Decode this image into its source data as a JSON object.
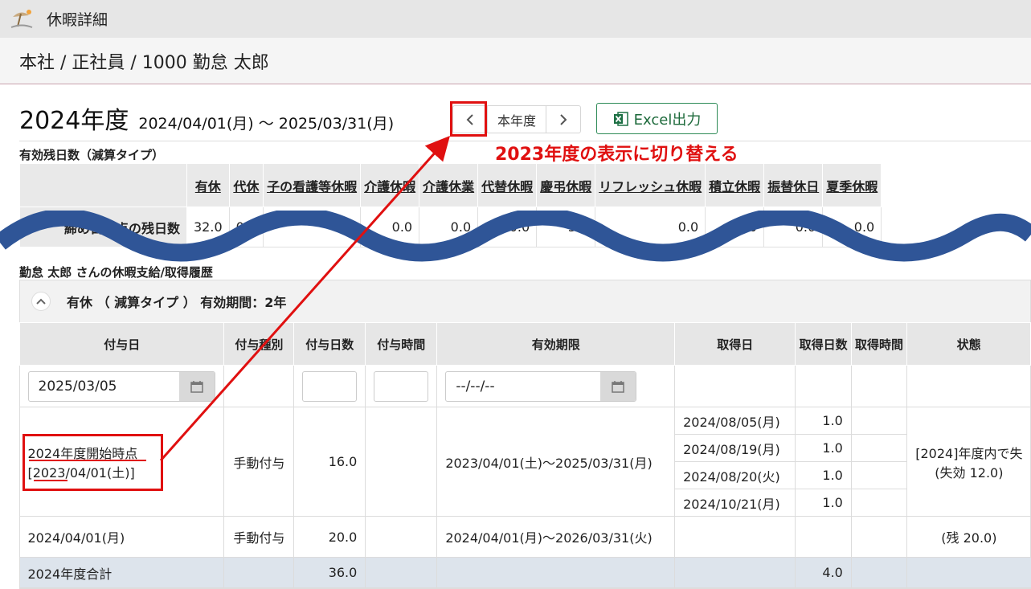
{
  "window": {
    "title": "休暇詳細"
  },
  "employee": {
    "path": "本社 / 正社員 / 1000 勤怠 太郎"
  },
  "year": {
    "title": "2024年度",
    "range": "2024/04/01(月) ～ 2025/03/31(月)",
    "current_label": "本年度",
    "excel_label": "Excel出力"
  },
  "annotation": {
    "text": "2023年度の表示に切り替える"
  },
  "balance": {
    "section_label": "有効残日数（減算タイプ）",
    "columns": [
      "有休",
      "代休",
      "子の看護等休暇",
      "介護休暇",
      "介護休業",
      "代替休暇",
      "慶弔休暇",
      "リフレッシュ休暇",
      "積立休暇",
      "振替休日",
      "夏季休暇"
    ],
    "row_label": "締め日時点の残日数",
    "values": [
      "32.0",
      "0.0",
      "0.0",
      "0.0",
      "0.0",
      "0.0",
      "3.0",
      "0.0",
      "0.0",
      "0.0",
      "0.0"
    ]
  },
  "history": {
    "section_label": "勤怠 太郎 さんの休暇支給/取得履歴",
    "panel_title": "有休 （ 減算タイプ ） 有効期間：2年",
    "headers": [
      "付与日",
      "付与種別",
      "付与日数",
      "付与時間",
      "有効期限",
      "取得日",
      "取得日数",
      "取得時間",
      "状態"
    ],
    "filter_grant_date": "2025/03/05",
    "filter_expiry_placeholder": "--/--/--",
    "row1": {
      "grant_line1": "2024年度開始時点",
      "grant_line2": "[2023/04/01(土)]",
      "type": "手動付与",
      "days": "16.0",
      "expiry": "2023/04/01(土)～2025/03/31(月)",
      "status_line1": "[2024]年度内で失",
      "status_line2": "(失効 12.0)",
      "taken": [
        {
          "date": "2024/08/05(月)",
          "days": "1.0"
        },
        {
          "date": "2024/08/19(月)",
          "days": "1.0"
        },
        {
          "date": "2024/08/20(火)",
          "days": "1.0"
        },
        {
          "date": "2024/10/21(月)",
          "days": "1.0"
        }
      ]
    },
    "row2": {
      "grant": "2024/04/01(月)",
      "type": "手動付与",
      "days": "20.0",
      "expiry": "2024/04/01(月)～2026/03/31(火)",
      "status": "(残 20.0)"
    },
    "total": {
      "label": "2024年度合計",
      "days": "36.0",
      "taken_days": "4.0"
    }
  },
  "colors": {
    "accent_red": "#e01010",
    "wave_blue": "#2f5597",
    "excel_green": "#2e8b57"
  }
}
